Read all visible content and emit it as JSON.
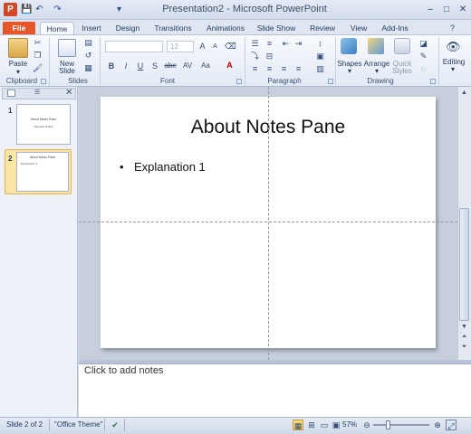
{
  "window": {
    "title": "Presentation2 - Microsoft PowerPoint",
    "app_icon_letter": "P",
    "controls": [
      "–",
      "□",
      "✕"
    ]
  },
  "qat": [
    "💾",
    "↶",
    "↷",
    "▾"
  ],
  "tabs": [
    "File",
    "Home",
    "Insert",
    "Design",
    "Transitions",
    "Animations",
    "Slide Show",
    "Review",
    "View",
    "Add-Ins"
  ],
  "ribbon": {
    "clipboard": {
      "paste_label": "Paste",
      "group_label": "Clipboard"
    },
    "slides": {
      "new_slide_label": "New",
      "new_slide_label2": "Slide",
      "group_label": "Slides"
    },
    "font": {
      "font_name": "",
      "font_size": "12",
      "group_label": "Font",
      "buttons": [
        "B",
        "I",
        "U",
        "S",
        "abe",
        "AV",
        "Aa"
      ]
    },
    "paragraph": {
      "group_label": "Paragraph"
    },
    "drawing": {
      "shapes_label": "Shapes",
      "arrange_label": "Arrange",
      "quick_styles_label": "Quick",
      "quick_styles_label2": "Styles",
      "group_label": "Drawing"
    },
    "editing": {
      "label": "Editing"
    }
  },
  "slides_panel": {
    "thumbnails": [
      {
        "number": "1",
        "title": "About Notes Pane",
        "subtitle": "Narrated bullets"
      },
      {
        "number": "2",
        "title": "About Notes Pane",
        "bullet": "Explanation 1"
      }
    ]
  },
  "slide": {
    "title": "About Notes Pane",
    "bullet_char": "•",
    "bullets": [
      "Explanation 1"
    ]
  },
  "notes": {
    "placeholder": "Click to add notes"
  },
  "status": {
    "slide_info": "Slide 2 of 2",
    "theme": "\"Office Theme\"",
    "zoom": "57%",
    "zoom_level": 0.57
  },
  "colors": {
    "file_tab": "#e5572a",
    "selected_thumb": "#fbe5a6",
    "ribbon_bg": "#e3eaf4"
  }
}
